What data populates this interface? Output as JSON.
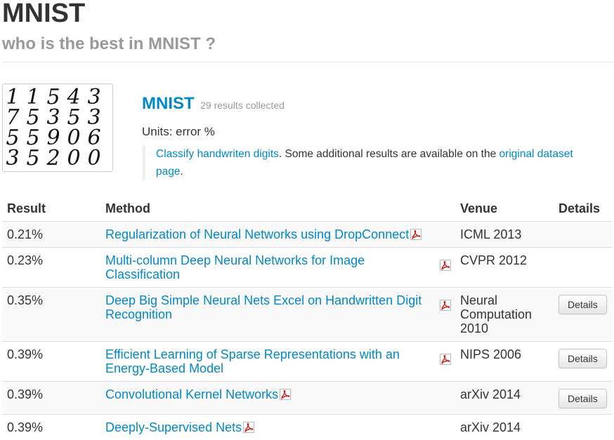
{
  "header": {
    "title": "MNIST",
    "subtitle": "who is the best in MNIST ?"
  },
  "dataset": {
    "name": "MNIST",
    "count": "29 results collected",
    "units": "Units: error %",
    "desc_link": "Classify handwriten digits",
    "desc_text": ". Some additional results are available on the ",
    "desc_link2": "original dataset page",
    "desc_end": "."
  },
  "table": {
    "headers": [
      "Result",
      "Method",
      "Venue",
      "Details"
    ],
    "rows": [
      {
        "result": "0.21%",
        "method": "Regularization of Neural Networks using DropConnect",
        "venue": "ICML 2013",
        "details": ""
      },
      {
        "result": "0.23%",
        "method": "Multi-column Deep Neural Networks for Image Classification",
        "venue": "CVPR 2012",
        "details": ""
      },
      {
        "result": "0.35%",
        "method": "Deep Big Simple Neural Nets Excel on Handwritten Digit Recognition",
        "venue": "Neural Computation 2010",
        "details": "Details"
      },
      {
        "result": "0.39%",
        "method": "Efficient Learning of Sparse Representations with an Energy-Based Model",
        "venue": "NIPS 2006",
        "details": "Details"
      },
      {
        "result": "0.39%",
        "method": "Convolutional Kernel Networks",
        "venue": "arXiv 2014",
        "details": "Details"
      },
      {
        "result": "0.39%",
        "method": "Deeply-Supervised Nets",
        "venue": "arXiv 2014",
        "details": ""
      }
    ]
  },
  "thumbnail": {
    "digits": [
      [
        "1",
        "1",
        "5",
        "4",
        "3"
      ],
      [
        "7",
        "5",
        "3",
        "5",
        "3"
      ],
      [
        "5",
        "5",
        "9",
        "0",
        "6"
      ],
      [
        "3",
        "5",
        "2",
        "0",
        "0"
      ]
    ]
  },
  "icons": {
    "pdf": "pdf-icon"
  },
  "colors": {
    "link": "#0088cc",
    "pdf_red": "#cc1f1f",
    "subtitle": "#999999"
  }
}
